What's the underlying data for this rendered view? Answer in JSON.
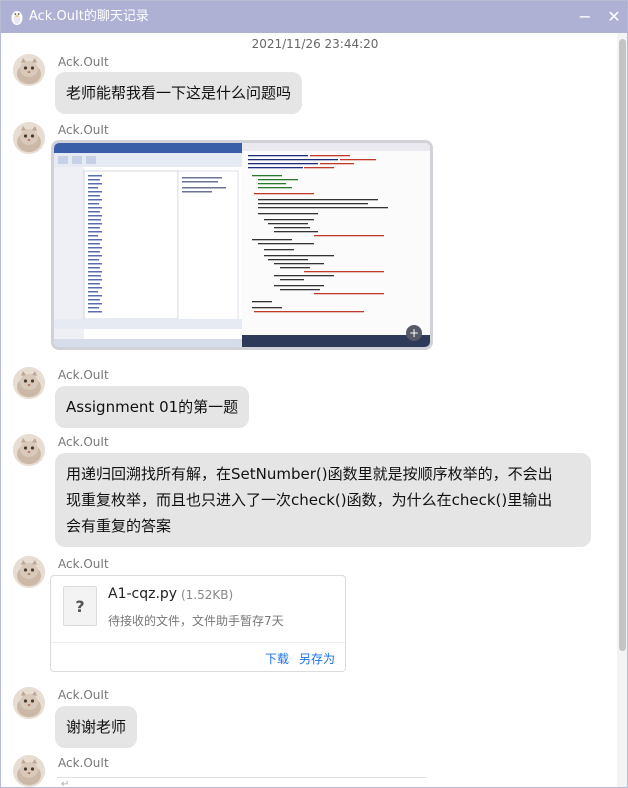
{
  "window": {
    "title": "Ack.OuIt的聊天记录",
    "minimize_glyph": "−",
    "close_glyph": "✕"
  },
  "chat": {
    "timestamp": "2021/11/26 23:44:20",
    "messages": [
      {
        "sender": "Ack.OuIt",
        "type": "text",
        "text": "老师能帮我看一下这是什么问题吗"
      },
      {
        "sender": "Ack.OuIt",
        "type": "image"
      },
      {
        "sender": "Ack.OuIt",
        "type": "text",
        "text": "Assignment 01的第一题"
      },
      {
        "sender": "Ack.OuIt",
        "type": "text",
        "lines": [
          "用递归回溯找所有解，在SetNumber()函数里就是按顺序枚举的，不会出",
          "现重复枚举，而且也只进入了一次check()函数，为什么在check()里输出",
          "会有重复的答案"
        ]
      },
      {
        "sender": "Ack.OuIt",
        "type": "file",
        "file": {
          "name": "A1-cqz.py",
          "size": "(1.52KB)",
          "status": "待接收的文件，文件助手暂存7天",
          "icon": "?",
          "download": "下载",
          "save_as": "另存为"
        }
      },
      {
        "sender": "Ack.OuIt",
        "type": "text",
        "text": "谢谢老师"
      },
      {
        "sender": "Ack.OuIt",
        "type": "partial"
      }
    ]
  },
  "colors": {
    "titlebar": "#aeb1d3",
    "bubble": "#e5e5e5",
    "link": "#1a73e8"
  },
  "icons": {
    "title": "penguin-icon",
    "avatar": "cat-avatar",
    "file": "unknown-file-icon"
  },
  "input": {
    "cursor_mark": "↵"
  }
}
